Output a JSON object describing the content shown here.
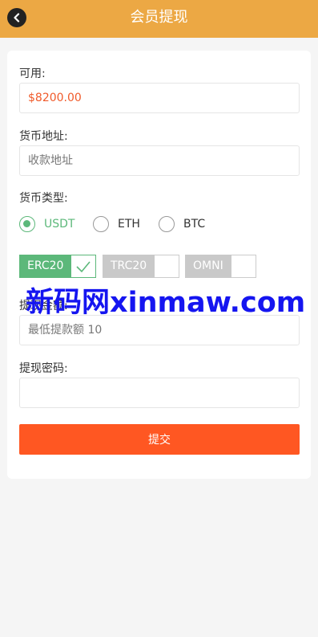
{
  "header": {
    "title": "会员提现",
    "back_icon": "chevron-left-icon"
  },
  "form": {
    "available_label": "可用:",
    "available_value": "$8200.00",
    "address_label": "货币地址:",
    "address_placeholder": "收款地址",
    "type_label": "货币类型:",
    "currencies": [
      {
        "label": "USDT",
        "checked": true
      },
      {
        "label": "ETH",
        "checked": false
      },
      {
        "label": "BTC",
        "checked": false
      }
    ],
    "chains": [
      {
        "label": "ERC20",
        "selected": true
      },
      {
        "label": "TRC20",
        "selected": false
      },
      {
        "label": "OMNI",
        "selected": false
      }
    ],
    "amount_label": "提现金额:",
    "amount_placeholder": "最低提款额 10",
    "password_label": "提现密码:",
    "password_value": "",
    "submit_label": "提交"
  },
  "watermark": "新码网xinmaw.com",
  "colors": {
    "header": "#eca844",
    "accent_green": "#5cb87a",
    "submit": "#ff5722",
    "value_red": "#f05a2a"
  }
}
